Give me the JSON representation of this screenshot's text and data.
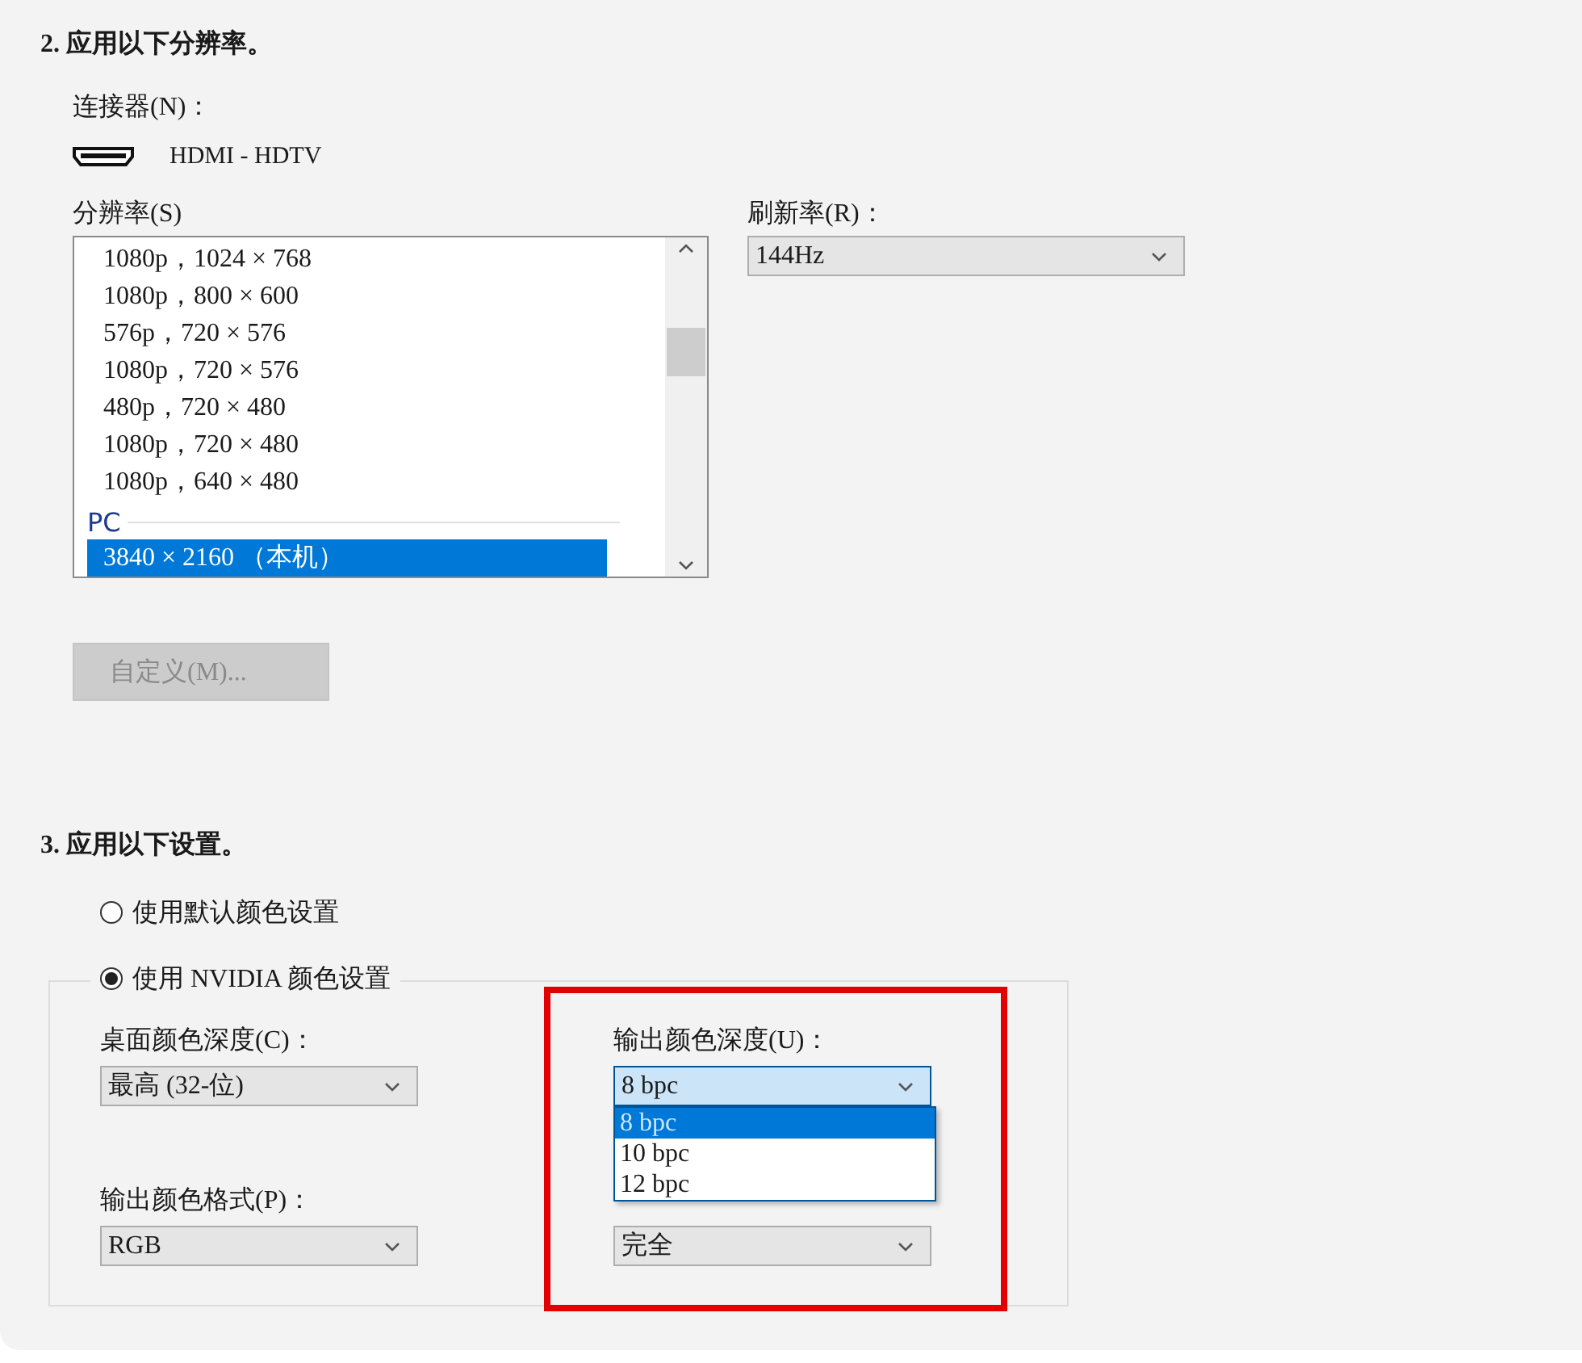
{
  "section_2": {
    "heading": "2. 应用以下分辨率。",
    "connector": {
      "label": "连接器(N)：",
      "value": "HDMI - HDTV"
    },
    "resolution": {
      "label": "分辨率(S)",
      "groups": [
        {
          "items": [
            {
              "text": "1080p，1024 × 768",
              "selected": false
            },
            {
              "text": "1080p，800 × 600",
              "selected": false
            },
            {
              "text": "576p，720 × 576",
              "selected": false
            },
            {
              "text": "1080p，720 × 576",
              "selected": false
            },
            {
              "text": "480p，720 × 480",
              "selected": false
            },
            {
              "text": "1080p，720 × 480",
              "selected": false
            },
            {
              "text": "1080p，640 × 480",
              "selected": false
            }
          ]
        },
        {
          "header": "PC",
          "items": [
            {
              "text": "3840 × 2160 （本机）",
              "selected": true
            }
          ]
        }
      ]
    },
    "refresh": {
      "label": "刷新率(R)：",
      "value": "144Hz"
    },
    "custom_button": {
      "label": "自定义(M)...",
      "disabled": true
    }
  },
  "section_3": {
    "heading": "3. 应用以下设置。",
    "color_modes": [
      {
        "label": "使用默认颜色设置",
        "selected": false
      },
      {
        "label": "使用 NVIDIA 颜色设置",
        "selected": true
      }
    ],
    "desktop_depth": {
      "label": "桌面颜色深度(C)：",
      "value": "最高 (32-位)"
    },
    "output_format": {
      "label": "输出颜色格式(P)：",
      "value": "RGB"
    },
    "output_depth": {
      "label": "输出颜色深度(U)：",
      "value": "8 bpc",
      "expanded": true,
      "options": [
        {
          "text": "8 bpc",
          "selected": true
        },
        {
          "text": "10 bpc",
          "selected": false
        },
        {
          "text": "12 bpc",
          "selected": false
        }
      ]
    },
    "dynamic_range": {
      "value": "完全"
    },
    "annotation": {
      "kind": "highlight-frame"
    }
  }
}
